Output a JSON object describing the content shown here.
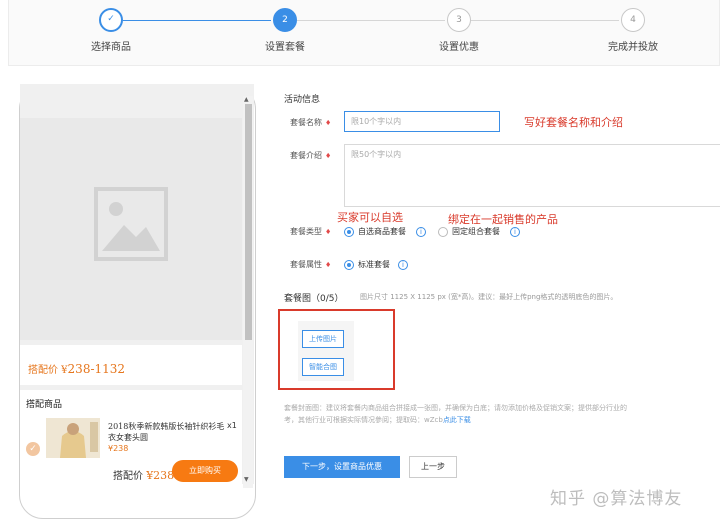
{
  "stepper": {
    "steps": [
      {
        "number": "✓",
        "label": "选择商品",
        "state": "done"
      },
      {
        "number": "2",
        "label": "设置套餐",
        "state": "current"
      },
      {
        "number": "3",
        "label": "设置优惠",
        "state": "todo"
      },
      {
        "number": "4",
        "label": "完成并投放",
        "state": "todo"
      }
    ]
  },
  "preview": {
    "price_prefix": "搭配价 ¥",
    "price_range": "238-1132",
    "combo_title": "搭配商品",
    "product": {
      "name": "2018秋季新款韩版长袖针织衫毛衣女套头圆",
      "qty": "x1",
      "price": "¥238"
    },
    "total_label": "搭配价 ",
    "total_value": "¥238",
    "buy_button": "立即购买"
  },
  "form": {
    "section_title": "活动信息",
    "name_label": "套餐名称",
    "name_placeholder": "限10个字以内",
    "intro_label": "套餐介绍",
    "intro_placeholder": "限50个字以内",
    "type_label": "套餐类型",
    "type_options": [
      "自选商品套餐",
      "固定组合套餐"
    ],
    "attr_label": "套餐属性",
    "attr_options": [
      "标准套餐"
    ],
    "image_title": "套餐图（0/5）",
    "image_hint": "图片尺寸 1125 X 1125 px (宽*高)。建议：最好上传png格式的透明底色的图片。",
    "upload_button": "上传图片",
    "smart_button": "智能合图",
    "desc_line1": "套餐封面图：建议将套餐内商品组合拼接成一张图，并确保为白底；请勿添加价格及促销文案；提供部分行业的",
    "desc_line2_a": "考，其他行业可根据实际情况參阅；提取码：wZcb",
    "desc_line2_link": "点此下载",
    "next_button": "下一步，设置商品优惠",
    "prev_button": "上一步"
  },
  "annotations": {
    "name_note": "写好套餐名称和介绍",
    "type_note_1": "买家可以自选",
    "type_note_2": "绑定在一起销售的产品"
  },
  "watermark": "知乎 @算法博友",
  "colors": {
    "primary": "#3a8ee6",
    "annotation_red": "#d93a2b",
    "price_orange": "#e6761d",
    "buy_orange": "#f77a12"
  }
}
